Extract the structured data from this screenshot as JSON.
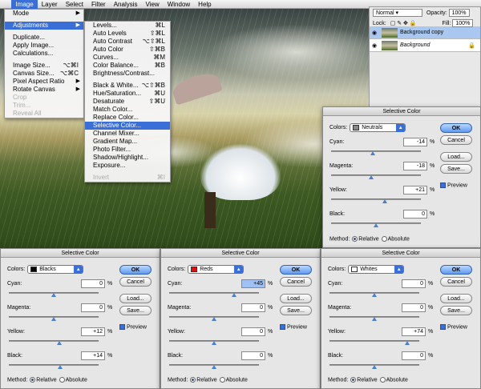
{
  "menubar": {
    "items": [
      "Image",
      "Layer",
      "Select",
      "Filter",
      "Analysis",
      "View",
      "Window",
      "Help"
    ],
    "active": "Image"
  },
  "image_menu": {
    "items": [
      {
        "label": "Mode",
        "shortcut": "",
        "arrow": true,
        "state": "normal"
      },
      {
        "sep": true
      },
      {
        "label": "Adjustments",
        "shortcut": "",
        "arrow": true,
        "state": "selected"
      },
      {
        "sep": true
      },
      {
        "label": "Duplicate...",
        "shortcut": "",
        "arrow": false,
        "state": "normal"
      },
      {
        "label": "Apply Image...",
        "shortcut": "",
        "arrow": false,
        "state": "normal"
      },
      {
        "label": "Calculations...",
        "shortcut": "",
        "arrow": false,
        "state": "normal"
      },
      {
        "sep": true
      },
      {
        "label": "Image Size...",
        "shortcut": "⌥⌘I",
        "arrow": false,
        "state": "normal"
      },
      {
        "label": "Canvas Size...",
        "shortcut": "⌥⌘C",
        "arrow": false,
        "state": "normal"
      },
      {
        "label": "Pixel Aspect Ratio",
        "shortcut": "",
        "arrow": true,
        "state": "normal"
      },
      {
        "label": "Rotate Canvas",
        "shortcut": "",
        "arrow": true,
        "state": "normal"
      },
      {
        "label": "Crop",
        "shortcut": "",
        "arrow": false,
        "state": "disabled"
      },
      {
        "label": "Trim...",
        "shortcut": "",
        "arrow": false,
        "state": "disabled"
      },
      {
        "label": "Reveal All",
        "shortcut": "",
        "arrow": false,
        "state": "disabled"
      }
    ]
  },
  "adjust_menu": {
    "items": [
      {
        "label": "Levels...",
        "shortcut": "⌘L",
        "state": "normal"
      },
      {
        "label": "Auto Levels",
        "shortcut": "⇧⌘L",
        "state": "normal"
      },
      {
        "label": "Auto Contrast",
        "shortcut": "⌥⇧⌘L",
        "state": "normal"
      },
      {
        "label": "Auto Color",
        "shortcut": "⇧⌘B",
        "state": "normal"
      },
      {
        "label": "Curves...",
        "shortcut": "⌘M",
        "state": "normal"
      },
      {
        "label": "Color Balance...",
        "shortcut": "⌘B",
        "state": "normal"
      },
      {
        "label": "Brightness/Contrast...",
        "shortcut": "",
        "state": "normal"
      },
      {
        "sep": true
      },
      {
        "label": "Black & White...",
        "shortcut": "⌥⇧⌘B",
        "state": "normal"
      },
      {
        "label": "Hue/Saturation...",
        "shortcut": "⌘U",
        "state": "normal"
      },
      {
        "label": "Desaturate",
        "shortcut": "⇧⌘U",
        "state": "normal"
      },
      {
        "label": "Match Color...",
        "shortcut": "",
        "state": "normal"
      },
      {
        "label": "Replace Color...",
        "shortcut": "",
        "state": "normal"
      },
      {
        "label": "Selective Color...",
        "shortcut": "",
        "state": "selected"
      },
      {
        "label": "Channel Mixer...",
        "shortcut": "",
        "state": "normal"
      },
      {
        "label": "Gradient Map...",
        "shortcut": "",
        "state": "normal"
      },
      {
        "label": "Photo Filter...",
        "shortcut": "",
        "state": "normal"
      },
      {
        "label": "Shadow/Highlight...",
        "shortcut": "",
        "state": "normal"
      },
      {
        "label": "Exposure...",
        "shortcut": "",
        "state": "normal"
      },
      {
        "sep": true
      },
      {
        "label": "Invert",
        "shortcut": "⌘I",
        "state": "disabled"
      }
    ]
  },
  "layers": {
    "blend_mode": "Normal",
    "opacity_label": "Opacity:",
    "opacity": "100%",
    "lock_label": "Lock:",
    "fill_label": "Fill:",
    "fill": "100%",
    "rows": [
      {
        "name": "Background copy",
        "selected": true,
        "italic": false
      },
      {
        "name": "Background",
        "selected": false,
        "italic": true
      }
    ]
  },
  "dialogs": [
    {
      "title": "Selective Color",
      "colors_label": "Colors:",
      "color_name": "Neutrals",
      "swatch": "#888888",
      "fields": [
        {
          "label": "Cyan:",
          "value": "-14",
          "hl": false,
          "pos": 0.46
        },
        {
          "label": "Magenta:",
          "value": "-18",
          "hl": false,
          "pos": 0.45
        },
        {
          "label": "Yellow:",
          "value": "+21",
          "hl": false,
          "pos": 0.6
        },
        {
          "label": "Black:",
          "value": "0",
          "hl": false,
          "pos": 0.5
        }
      ],
      "ok": "OK",
      "cancel": "Cancel",
      "load": "Load...",
      "save": "Save...",
      "preview": "Preview",
      "method_label": "Method:",
      "relative": "Relative",
      "absolute": "Absolute"
    },
    {
      "title": "Selective Color",
      "colors_label": "Colors:",
      "color_name": "Blacks",
      "swatch": "#000000",
      "fields": [
        {
          "label": "Cyan:",
          "value": "0",
          "hl": false,
          "pos": 0.5
        },
        {
          "label": "Magenta:",
          "value": "0",
          "hl": false,
          "pos": 0.5
        },
        {
          "label": "Yellow:",
          "value": "+12",
          "hl": false,
          "pos": 0.56
        },
        {
          "label": "Black:",
          "value": "+14",
          "hl": false,
          "pos": 0.57
        }
      ],
      "ok": "OK",
      "cancel": "Cancel",
      "load": "Load...",
      "save": "Save...",
      "preview": "Preview",
      "method_label": "Method:",
      "relative": "Relative",
      "absolute": "Absolute"
    },
    {
      "title": "Selective Color",
      "colors_label": "Colors:",
      "color_name": "Reds",
      "swatch": "#e01010",
      "fields": [
        {
          "label": "Cyan:",
          "value": "+45",
          "hl": true,
          "pos": 0.72
        },
        {
          "label": "Magenta:",
          "value": "0",
          "hl": false,
          "pos": 0.5
        },
        {
          "label": "Yellow:",
          "value": "0",
          "hl": false,
          "pos": 0.5
        },
        {
          "label": "Black:",
          "value": "0",
          "hl": false,
          "pos": 0.5
        }
      ],
      "ok": "OK",
      "cancel": "Cancel",
      "load": "Load...",
      "save": "Save...",
      "preview": "Preview",
      "method_label": "Method:",
      "relative": "Relative",
      "absolute": "Absolute"
    },
    {
      "title": "Selective Color",
      "colors_label": "Colors:",
      "color_name": "Whites",
      "swatch": "#ffffff",
      "fields": [
        {
          "label": "Cyan:",
          "value": "0",
          "hl": false,
          "pos": 0.5
        },
        {
          "label": "Magenta:",
          "value": "0",
          "hl": false,
          "pos": 0.5
        },
        {
          "label": "Yellow:",
          "value": "+74",
          "hl": false,
          "pos": 0.87
        },
        {
          "label": "Black:",
          "value": "0",
          "hl": false,
          "pos": 0.5
        }
      ],
      "ok": "OK",
      "cancel": "Cancel",
      "load": "Load...",
      "save": "Save...",
      "preview": "Preview",
      "method_label": "Method:",
      "relative": "Relative",
      "absolute": "Absolute"
    }
  ]
}
